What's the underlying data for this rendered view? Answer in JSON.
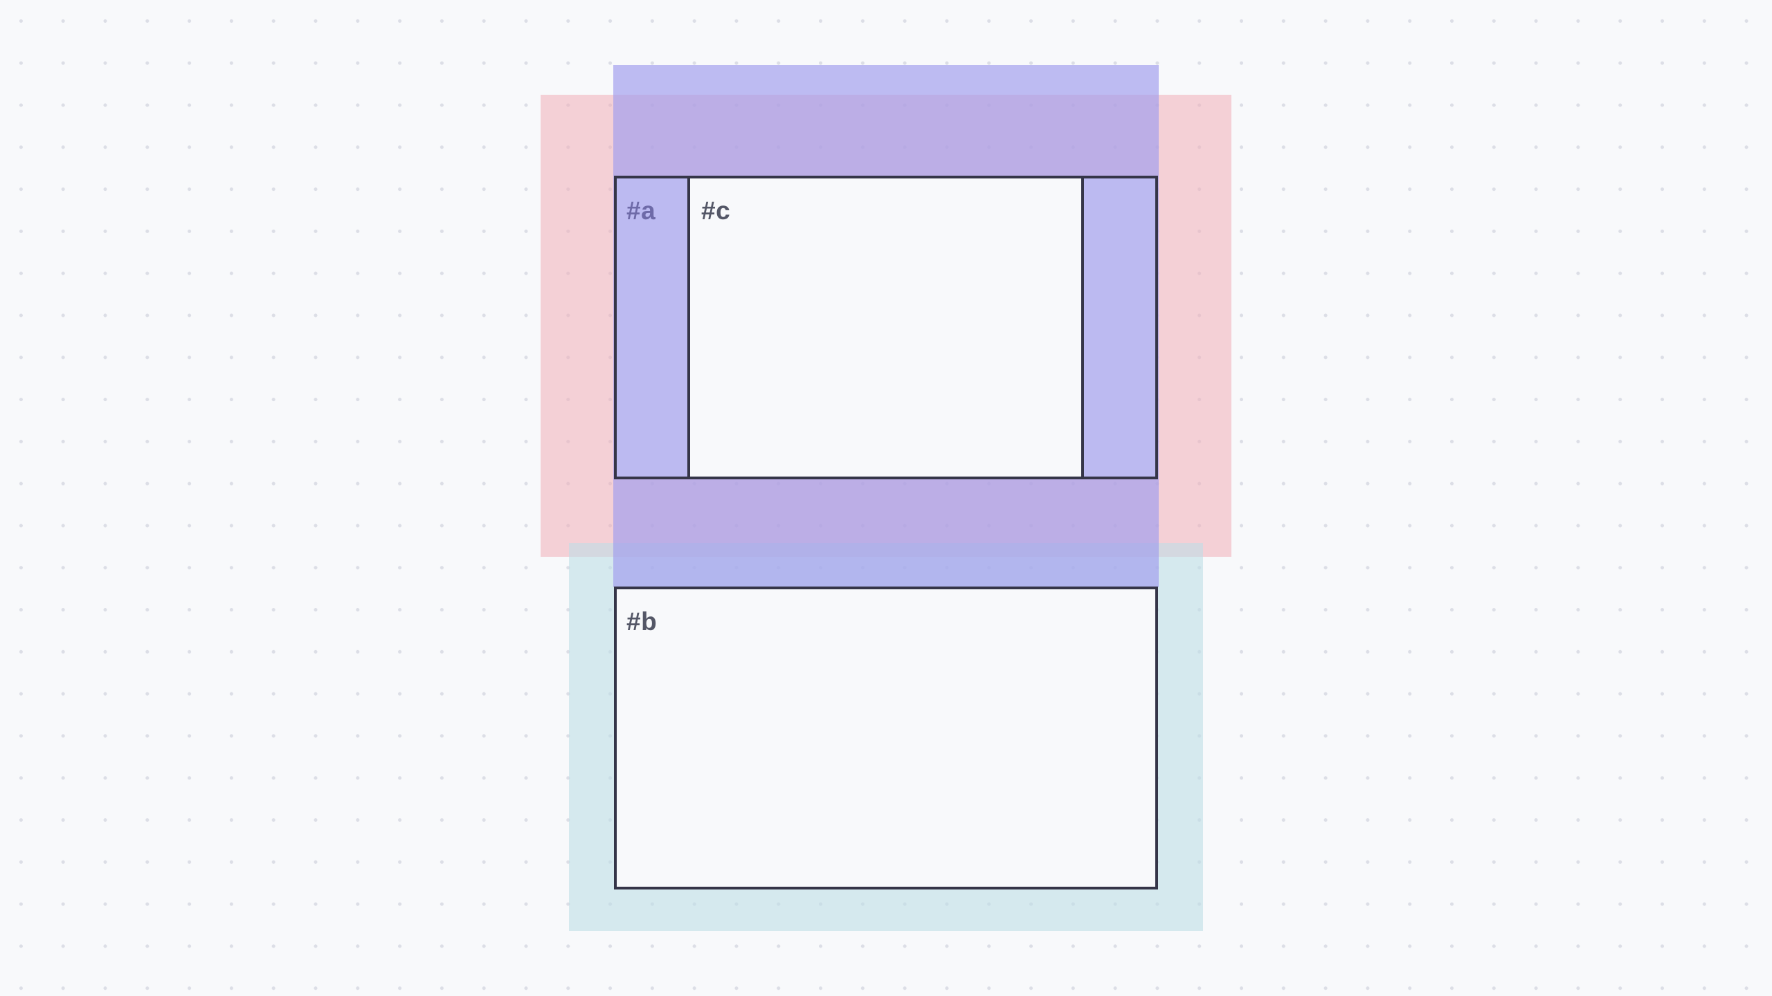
{
  "diagram": {
    "boxes": [
      {
        "id": "a",
        "label": "#a"
      },
      {
        "id": "b",
        "label": "#b"
      },
      {
        "id": "c",
        "label": "#c"
      }
    ]
  },
  "colors": {
    "canvas_background": "#f8f9fb",
    "grid_dot": "#dcdee6",
    "box_border": "#353548",
    "box_a_fill": "#bcbaf1",
    "box_b_fill": "#f8f9fb",
    "box_c_fill": "#f8f9fb",
    "margin_region_red": "#f2cfd4",
    "margin_region_blue": "#a7a6ee",
    "margin_region_teal": "#d6eaed",
    "label_a_color": "#6e6aa8",
    "label_dark_color": "#545767"
  }
}
